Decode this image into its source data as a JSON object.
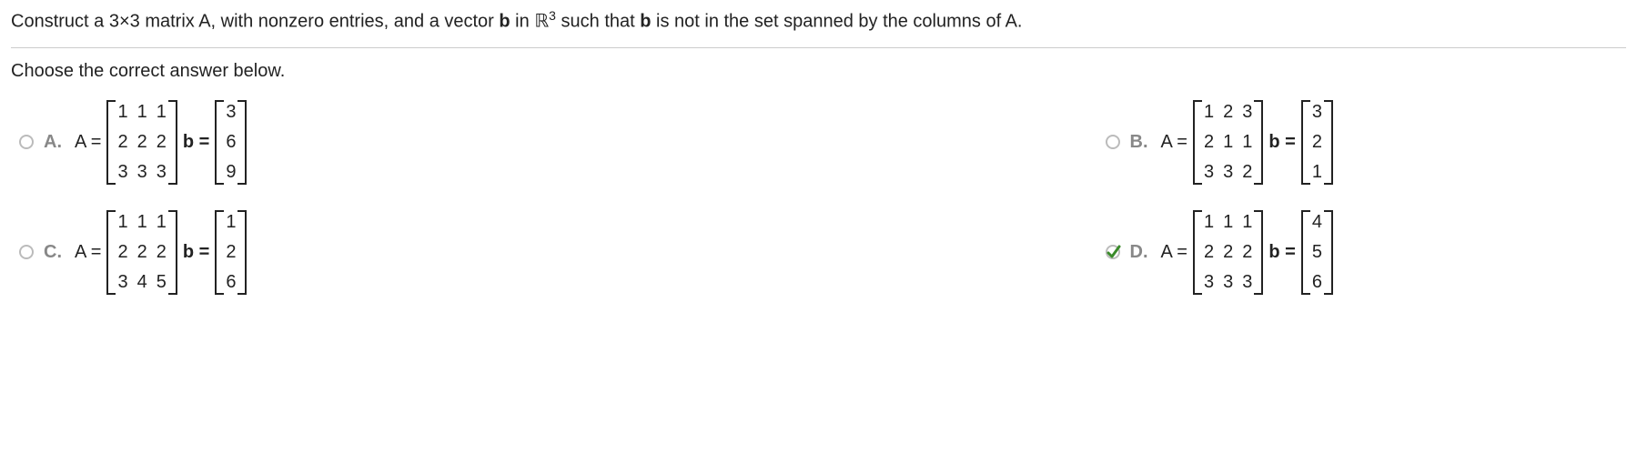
{
  "question": {
    "pre": "Construct a 3",
    "times": "×",
    "mid1": "3 matrix A, with nonzero entries, and a vector ",
    "b1": "b",
    "mid2": " in ",
    "R": "ℝ",
    "exp": "3",
    "mid3": " such that ",
    "b2": "b",
    "post": " is not in the set spanned by the columns of A."
  },
  "instruction": "Choose the correct answer below.",
  "labels": {
    "Aeq": "A =",
    "beq": "b ="
  },
  "choices": [
    {
      "letter": "A.",
      "selected": false,
      "A": [
        [
          "1",
          "1",
          "1"
        ],
        [
          "2",
          "2",
          "2"
        ],
        [
          "3",
          "3",
          "3"
        ]
      ],
      "b": [
        "3",
        "6",
        "9"
      ]
    },
    {
      "letter": "B.",
      "selected": false,
      "A": [
        [
          "1",
          "2",
          "3"
        ],
        [
          "2",
          "1",
          "1"
        ],
        [
          "3",
          "3",
          "2"
        ]
      ],
      "b": [
        "3",
        "2",
        "1"
      ]
    },
    {
      "letter": "C.",
      "selected": false,
      "A": [
        [
          "1",
          "1",
          "1"
        ],
        [
          "2",
          "2",
          "2"
        ],
        [
          "3",
          "4",
          "5"
        ]
      ],
      "b": [
        "1",
        "2",
        "6"
      ]
    },
    {
      "letter": "D.",
      "selected": true,
      "A": [
        [
          "1",
          "1",
          "1"
        ],
        [
          "2",
          "2",
          "2"
        ],
        [
          "3",
          "3",
          "3"
        ]
      ],
      "b": [
        "4",
        "5",
        "6"
      ]
    }
  ]
}
